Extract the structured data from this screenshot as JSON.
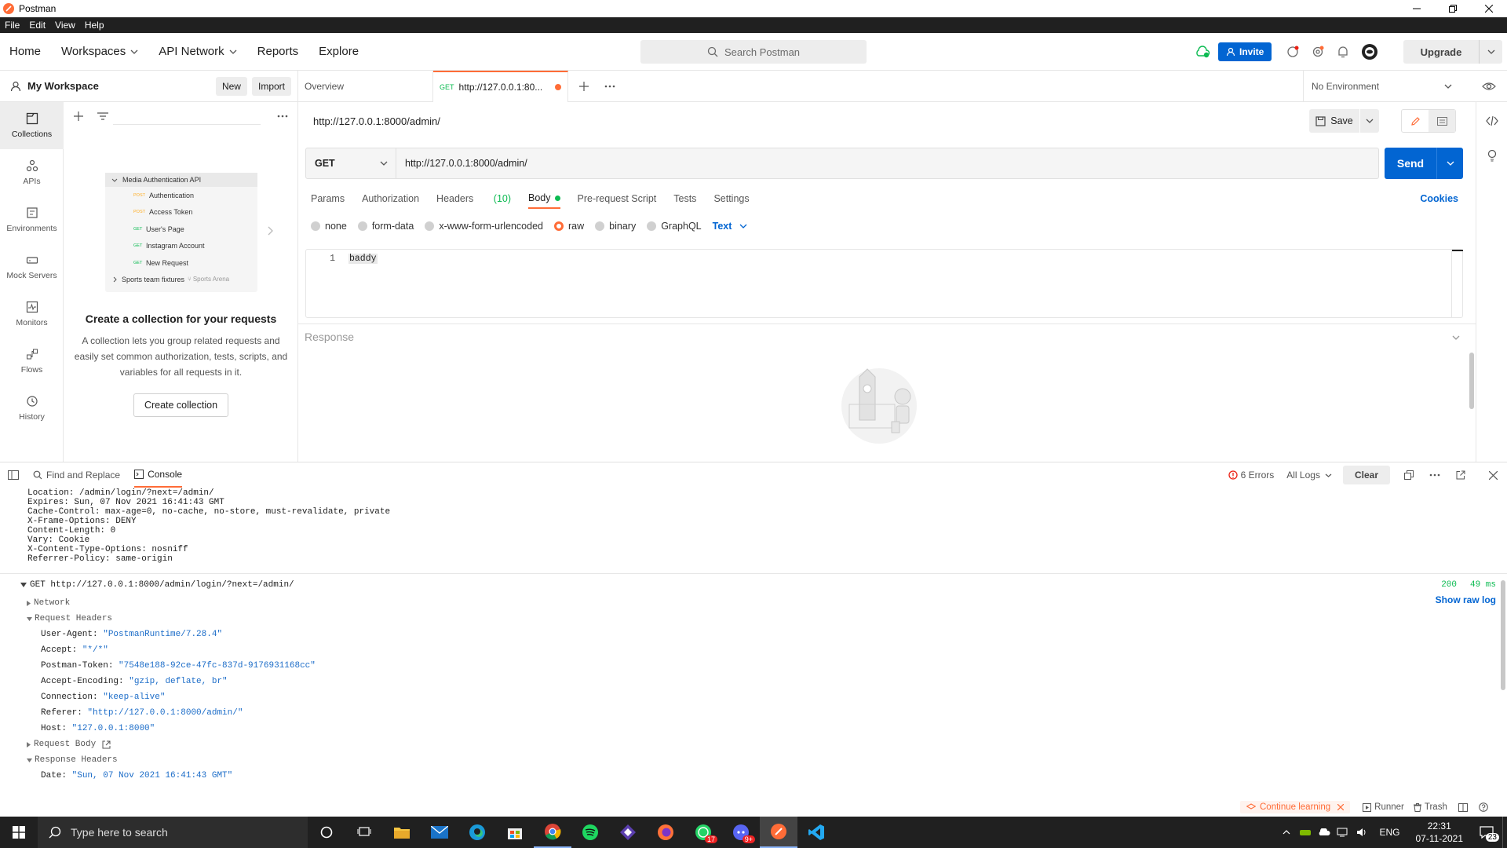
{
  "app": {
    "title": "Postman"
  },
  "menu": [
    "File",
    "Edit",
    "View",
    "Help"
  ],
  "header": {
    "nav": [
      "Home",
      "Workspaces",
      "API Network",
      "Reports",
      "Explore"
    ],
    "search_placeholder": "Search Postman",
    "invite": "Invite",
    "upgrade": "Upgrade"
  },
  "workspace": {
    "name": "My Workspace",
    "new": "New",
    "import": "Import"
  },
  "leftnav": [
    "Collections",
    "APIs",
    "Environments",
    "Mock Servers",
    "Monitors",
    "Flows",
    "History"
  ],
  "empty_state": {
    "illustration": {
      "collection": "Media Authentication API",
      "requests": [
        {
          "method": "POST",
          "name": "Authentication"
        },
        {
          "method": "POST",
          "name": "Access Token"
        },
        {
          "method": "GET",
          "name": "User's Page"
        },
        {
          "method": "GET",
          "name": "Instagram Account"
        },
        {
          "method": "GET",
          "name": "New Request"
        }
      ],
      "second_collection": "Sports team fixtures",
      "fork_label": "Sports Arena"
    },
    "title": "Create a collection for your requests",
    "body": "A collection lets you group related requests and easily set common authorization, tests, scripts, and variables for all requests in it.",
    "button": "Create collection"
  },
  "tabs": {
    "overview": "Overview",
    "active": {
      "method": "GET",
      "label": "http://127.0.0.1:80..."
    },
    "environment": "No Environment"
  },
  "request": {
    "title": "http://127.0.0.1:8000/admin/",
    "save": "Save",
    "method": "GET",
    "url": "http://127.0.0.1:8000/admin/",
    "send": "Send",
    "tabs": [
      "Params",
      "Authorization",
      "Headers",
      "Body",
      "Pre-request Script",
      "Tests",
      "Settings"
    ],
    "headers_count": "(10)",
    "cookies": "Cookies",
    "body_types": [
      "none",
      "form-data",
      "x-www-form-urlencoded",
      "raw",
      "binary",
      "GraphQL"
    ],
    "body_format": "Text",
    "editor_line": "1",
    "editor_text": "baddy",
    "response_label": "Response"
  },
  "console": {
    "find_replace": "Find and Replace",
    "console_tab": "Console",
    "errors": "6 Errors",
    "all_logs": "All Logs",
    "clear": "Clear",
    "raw_lines": [
      "Location: /admin/login/?next=/admin/",
      "Expires: Sun, 07 Nov 2021 16:41:43 GMT",
      "Cache-Control: max-age=0, no-cache, no-store, must-revalidate, private",
      "X-Frame-Options: DENY",
      "Content-Length: 0",
      "Vary: Cookie",
      "X-Content-Type-Options: nosniff",
      "Referrer-Policy: same-origin"
    ],
    "entry": {
      "title": "GET http://127.0.0.1:8000/admin/login/?next=/admin/",
      "status": "200",
      "time": "49 ms",
      "show_raw": "Show raw log",
      "network": "Network",
      "request_headers": "Request Headers",
      "headers": [
        {
          "k": "User-Agent:",
          "v": "\"PostmanRuntime/7.28.4\""
        },
        {
          "k": "Accept:",
          "v": "\"*/*\""
        },
        {
          "k": "Postman-Token:",
          "v": "\"7548e188-92ce-47fc-837d-9176931168cc\""
        },
        {
          "k": "Accept-Encoding:",
          "v": "\"gzip, deflate, br\""
        },
        {
          "k": "Connection:",
          "v": "\"keep-alive\""
        },
        {
          "k": "Referer:",
          "v": "\"http://127.0.0.1:8000/admin/\""
        },
        {
          "k": "Host:",
          "v": "\"127.0.0.1:8000\""
        }
      ],
      "request_body": "Request Body",
      "response_headers": "Response Headers",
      "date_key": "Date:",
      "date_val": "\"Sun, 07 Nov 2021 16:41:43 GMT\""
    }
  },
  "status_bar": {
    "continue": "Continue learning",
    "runner": "Runner",
    "trash": "Trash"
  },
  "taskbar": {
    "search": "Type here to search",
    "lang": "ENG",
    "time": "22:31",
    "date": "07-11-2021",
    "notif": "23",
    "badge_whatsapp": "17",
    "badge_discord": "9+"
  },
  "colors": {
    "accent": "#ff6c37",
    "primary": "#0265d2",
    "get": "#0cbb52",
    "post": "#ffad21",
    "error": "#eb2013"
  }
}
